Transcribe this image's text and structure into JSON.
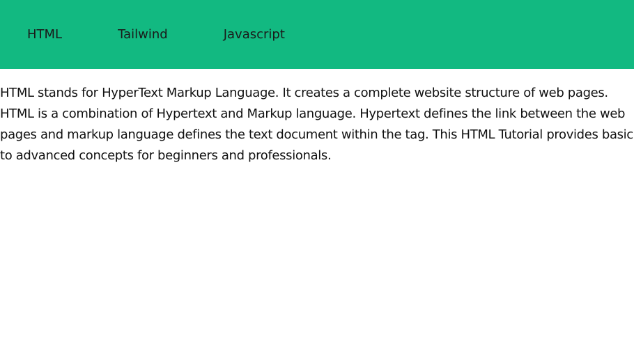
{
  "theme": {
    "nav_bg": "#12b981",
    "page_bg": "#ffffff",
    "text": "#111111"
  },
  "nav": {
    "items": [
      {
        "label": "HTML"
      },
      {
        "label": "Tailwind"
      },
      {
        "label": "Javascript"
      }
    ]
  },
  "main": {
    "paragraph": "HTML stands for HyperText Markup Language. It creates a complete website structure of web pages. HTML is a combination of Hypertext and Markup language. Hypertext defines the link between the web pages and markup language defines the text document within the tag. This HTML Tutorial provides basic to advanced concepts for beginners and professionals."
  }
}
